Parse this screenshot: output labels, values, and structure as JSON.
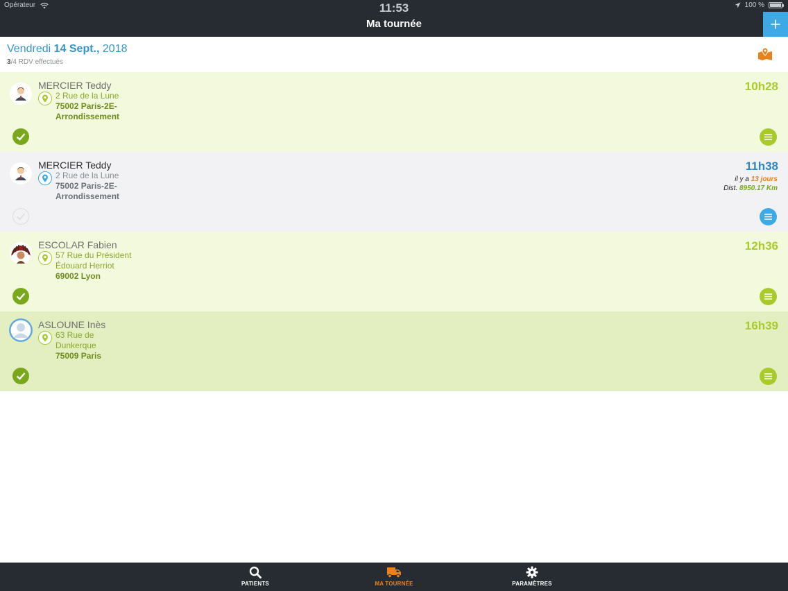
{
  "status_bar": {
    "carrier": "Opérateur",
    "time": "11:53",
    "battery": "100 %"
  },
  "nav": {
    "title": "Ma tournée",
    "add_icon": "plus-icon"
  },
  "header": {
    "weekday": "Vendredi",
    "date_bold": "14 Sept.,",
    "year": "2018",
    "done_count": "3",
    "count_rest": "/4 RDV effectués",
    "map_icon": "map-pin-icon"
  },
  "appointments": [
    {
      "name": "MERCIER Teddy",
      "street": "2 Rue de la Lune",
      "city": "75002 Paris-2E-Arrondissement",
      "time": "10h28",
      "done": true,
      "avatar": "man-avatar"
    },
    {
      "name": "MERCIER Teddy",
      "street": "2 Rue de la Lune",
      "city": "75002 Paris-2E-Arrondissement",
      "time": "11h38",
      "ago_prefix": "il y a",
      "ago_value": "13 jours",
      "dist_prefix": "Dist.",
      "dist_value": "8950.17 Km",
      "done": false,
      "avatar": "man-avatar"
    },
    {
      "name": "ESCOLAR Fabien",
      "street": "57 Rue du Président Édouard Herriot",
      "city": "69002 Lyon",
      "time": "12h36",
      "done": true,
      "avatar": "headdress-avatar"
    },
    {
      "name": "ASLOUNE Inès",
      "street": "63 Rue de Dunkerque",
      "city": "75009 Paris",
      "time": "16h39",
      "done": true,
      "avatar": "default-avatar"
    }
  ],
  "tabs": [
    {
      "label": "PATIENTS",
      "icon": "search-icon",
      "active": false
    },
    {
      "label": "MA TOURNÉE",
      "icon": "truck-icon",
      "active": true
    },
    {
      "label": "PARAMÈTRES",
      "icon": "gear-icon",
      "active": false
    }
  ],
  "colors": {
    "nav_bg": "#262c31",
    "accent_blue": "#3fa9e6",
    "accent_orange": "#e8821e",
    "done_green": "#7aa81c",
    "lime": "#a8cb2b"
  }
}
